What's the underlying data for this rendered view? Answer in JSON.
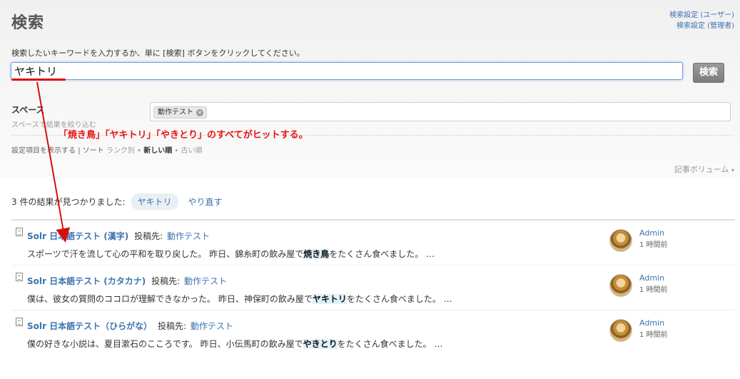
{
  "header": {
    "title": "検索",
    "settings_user": "検索設定 (ユーザー)",
    "settings_admin": "検索設定 (管理者)"
  },
  "search": {
    "instructions": "検索したいキーワードを入力するか、単に [検索] ボタンをクリックしてください。",
    "query": "ヤキトリ",
    "button_label": "検索"
  },
  "filters": {
    "space_label": "スペース",
    "space_hint": "スペースで結果を絞り込む",
    "space_chip": "動作テスト",
    "chip_remove": "×"
  },
  "annotation": {
    "text": "「焼き鳥」「ヤキトリ」「やきとり」のすべてがヒットする。",
    "accent_color": "#e81212"
  },
  "sort": {
    "show_settings": "設定項目を表示する",
    "separator": "|",
    "sort_label": "ソート",
    "rank": "ランク別",
    "bullet": "•",
    "newest": "新しい順",
    "oldest": "古い順"
  },
  "volume": {
    "label": "記事ボリューム",
    "caret_icon": "▾"
  },
  "results": {
    "summary": "3 件の結果が見つかりました:",
    "query_pill": "ヤキトリ",
    "retry": "やり直す",
    "items": [
      {
        "title": "Solr 日本語テスト (漢字)",
        "posted_in": "投稿先:",
        "space": "動作テスト",
        "excerpt_before": "スポーツで汗を流して心の平和を取り戻した。 昨日、錦糸町の飲み屋で",
        "highlight": "焼き鳥",
        "excerpt_after": "をたくさん食べました。 …",
        "author": "Admin",
        "time": "1 時間前"
      },
      {
        "title": "Solr 日本語テスト (カタカナ)",
        "posted_in": "投稿先:",
        "space": "動作テスト",
        "excerpt_before": "僕は、彼女の質問のココロが理解できなかった。 昨日、神保町の飲み屋で",
        "highlight": "ヤキトリ",
        "excerpt_after": "をたくさん食べました。 …",
        "author": "Admin",
        "time": "1 時間前"
      },
      {
        "title": "Solr 日本語テスト（ひらがな）",
        "posted_in": "投稿先:",
        "space": "動作テスト",
        "excerpt_before": "僕の好きな小説は、夏目漱石のこころです。 昨日、小伝馬町の飲み屋で",
        "highlight": "やきとり",
        "excerpt_after": "をたくさん食べました。 …",
        "author": "Admin",
        "time": "1 時間前"
      }
    ]
  }
}
